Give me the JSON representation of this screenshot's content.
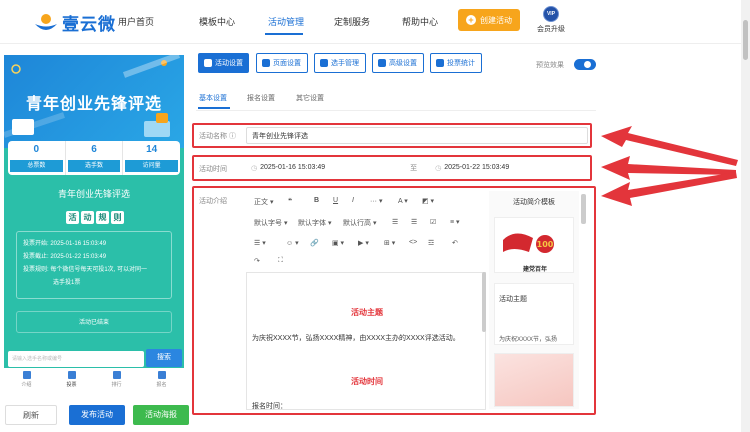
{
  "header": {
    "logo_text": "壹云微",
    "nav": [
      {
        "label": "用户首页"
      },
      {
        "label": "模板中心"
      },
      {
        "label": "活动管理"
      },
      {
        "label": "定制服务"
      },
      {
        "label": "帮助中心"
      }
    ],
    "create_label": "创建活动",
    "vip_badge": "VIP",
    "vip_label": "会员升级"
  },
  "preview": {
    "title": "青年创业先锋评选",
    "stats": [
      {
        "value": "0",
        "label": "总票数"
      },
      {
        "value": "6",
        "label": "选手数"
      },
      {
        "value": "14",
        "label": "访问量"
      }
    ],
    "sub_title": "青年创业先锋评选",
    "rules_chars": [
      "活",
      "动",
      "规",
      "则"
    ],
    "info": {
      "start": "投票开始: 2025-01-16 15:03:49",
      "end": "投票截止: 2025-01-22 15:03:49",
      "rule": "投票规则: 每个微信号每天可投1次, 可以对同一",
      "rule2": "选手投1票"
    },
    "status": "活动已结束",
    "search_placeholder": "请输入选手名称或编号",
    "search_button": "搜索",
    "bottom_nav": [
      {
        "label": "介绍"
      },
      {
        "label": "投票"
      },
      {
        "label": "排行"
      },
      {
        "label": "报名"
      }
    ]
  },
  "actions": {
    "refresh": "刷新",
    "publish": "发布活动",
    "poster": "活动海报"
  },
  "tabs": [
    {
      "label": "活动设置"
    },
    {
      "label": "页面设置"
    },
    {
      "label": "选手管理"
    },
    {
      "label": "高级设置"
    },
    {
      "label": "投票统计"
    }
  ],
  "preview_toggle_label": "预览效果",
  "subtabs": [
    {
      "label": "基本设置"
    },
    {
      "label": "报名设置"
    },
    {
      "label": "其它设置"
    }
  ],
  "form": {
    "name_label": "活动名称 ⓘ",
    "name_value": "青年创业先锋评选",
    "time_label": "活动时间",
    "start_time": "2025-01-16 15:03:49",
    "time_sep": "至",
    "end_time": "2025-01-22 15:03:49",
    "intro_label": "活动介绍"
  },
  "editor": {
    "tools_row1": [
      "正文 ▾",
      "❝",
      "B",
      "U",
      "I",
      "··· ▾",
      "A ▾",
      "◩ ▾"
    ],
    "tools_row2": [
      "默认字号 ▾",
      "默认字体 ▾",
      "默认行高 ▾",
      "☰",
      "☰",
      "☑",
      "≡ ▾"
    ],
    "tools_row3": [
      "☰ ▾",
      "☺ ▾",
      "🔗",
      "▣ ▾",
      "▶ ▾",
      "⊞ ▾",
      "<>",
      "☲",
      "↶"
    ],
    "tools_row4": [
      "↷",
      "⛶"
    ],
    "heading1": "活动主题",
    "para1": "为庆祝XXXX节，弘扬XXXX精神，由XXXX主办的XXXX评选活动。",
    "heading2": "活动时间",
    "para2": "报名时间："
  },
  "templates": {
    "title": "活动简介模板",
    "card1_caption": "建党百年",
    "card2_title": "活动主题",
    "card2_text": "为庆祝XXXX节，弘扬"
  },
  "colors": {
    "primary": "#1a6fd4",
    "accent_orange": "#f7a51c",
    "green": "#2bbfa9",
    "red_box": "#e3353b"
  }
}
